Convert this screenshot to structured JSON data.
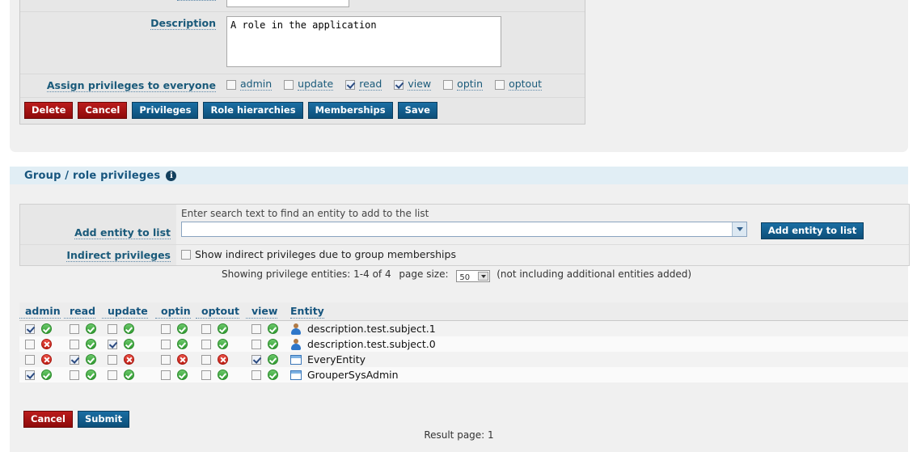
{
  "edit_form": {
    "description_label": "Description",
    "description_value": "A role in the application",
    "everyone_label": "Assign privileges to everyone",
    "everyone_privileges": [
      {
        "label": "admin",
        "checked": false
      },
      {
        "label": "update",
        "checked": false
      },
      {
        "label": "read",
        "checked": true
      },
      {
        "label": "view",
        "checked": true
      },
      {
        "label": "optin",
        "checked": false
      },
      {
        "label": "optout",
        "checked": false
      }
    ],
    "buttons": [
      {
        "label": "Delete",
        "style": "red"
      },
      {
        "label": "Cancel",
        "style": "red"
      },
      {
        "label": "Privileges",
        "style": "blue"
      },
      {
        "label": "Role hierarchies",
        "style": "blue"
      },
      {
        "label": "Memberships",
        "style": "blue"
      },
      {
        "label": "Save",
        "style": "blue"
      }
    ]
  },
  "privileges_panel": {
    "title": "Group / role privileges",
    "info_icon": "i",
    "add_entity": {
      "label": "Add entity to list",
      "hint": "Enter search text to find an entity to add to the list",
      "input_value": "",
      "button_label": "Add entity to list"
    },
    "indirect": {
      "label": "Indirect privileges",
      "checkbox_label": "Show indirect privileges due to group memberships",
      "checked": false
    },
    "showing": {
      "text": "Showing privilege entities: 1-4 of 4",
      "page_size_label": "page size:",
      "page_size_value": "50",
      "note": "(not including additional entities added)"
    },
    "columns": [
      "admin",
      "read",
      "update",
      "optin",
      "optout",
      "view",
      "Entity"
    ],
    "rows": [
      {
        "entity": "description.test.subject.1",
        "icon": "person-icon",
        "cells": [
          {
            "checked": true,
            "status": "ok"
          },
          {
            "checked": false,
            "status": "ok"
          },
          {
            "checked": false,
            "status": "ok"
          },
          {
            "checked": false,
            "status": "ok"
          },
          {
            "checked": false,
            "status": "ok"
          },
          {
            "checked": false,
            "status": "ok"
          }
        ]
      },
      {
        "entity": "description.test.subject.0",
        "icon": "person-icon",
        "cells": [
          {
            "checked": false,
            "status": "no"
          },
          {
            "checked": false,
            "status": "ok"
          },
          {
            "checked": true,
            "status": "ok"
          },
          {
            "checked": false,
            "status": "ok"
          },
          {
            "checked": false,
            "status": "ok"
          },
          {
            "checked": false,
            "status": "ok"
          }
        ]
      },
      {
        "entity": "EveryEntity",
        "icon": "group-icon",
        "cells": [
          {
            "checked": false,
            "status": "no"
          },
          {
            "checked": true,
            "status": "ok"
          },
          {
            "checked": false,
            "status": "no"
          },
          {
            "checked": false,
            "status": "no"
          },
          {
            "checked": false,
            "status": "no"
          },
          {
            "checked": true,
            "status": "ok"
          }
        ]
      },
      {
        "entity": "GrouperSysAdmin",
        "icon": "group-icon",
        "cells": [
          {
            "checked": true,
            "status": "ok"
          },
          {
            "checked": false,
            "status": "ok"
          },
          {
            "checked": false,
            "status": "ok"
          },
          {
            "checked": false,
            "status": "ok"
          },
          {
            "checked": false,
            "status": "ok"
          },
          {
            "checked": false,
            "status": "ok"
          }
        ]
      }
    ],
    "footer_buttons": [
      {
        "label": "Cancel",
        "style": "red"
      },
      {
        "label": "Submit",
        "style": "blue"
      }
    ],
    "result_page": "Result page: 1"
  },
  "colors": {
    "link_blue": "#16557e",
    "panel_gray": "#f0f0f0",
    "header_band": "#e1eef5",
    "btn_red": "#a81010",
    "btn_blue": "#125b8c",
    "status_ok": "#3fae3f",
    "status_no": "#d93025"
  }
}
